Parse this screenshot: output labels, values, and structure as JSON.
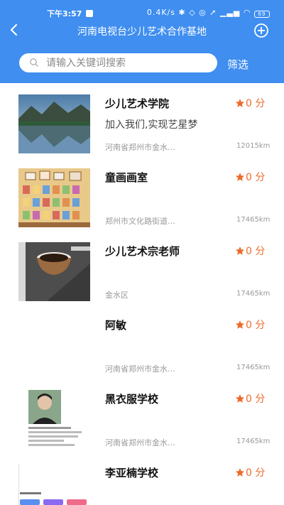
{
  "status_bar": {
    "time": "下午3:57",
    "speed": "0.4K/s",
    "icons": [
      "bluetooth-icon",
      "mute-icon",
      "alarm-icon",
      "location-icon",
      "signal-icon",
      "wifi-icon"
    ],
    "battery": "69"
  },
  "header": {
    "title": "河南电视台少儿艺术合作基地",
    "back_icon": "back-arrow-icon",
    "add_icon": "plus-circle-icon",
    "color": "#3f8ef0"
  },
  "search": {
    "placeholder": "请输入关键词搜索",
    "filter_label": "筛选"
  },
  "accent_color": "#ee6a2b",
  "items": [
    {
      "name": "少儿艺术学院",
      "rating": "0 分",
      "desc": "加入我们,实现艺星梦",
      "address": "河南省郑州市金水…",
      "distance": "12015km",
      "thumb": "lake-landscape"
    },
    {
      "name": "童画画室",
      "rating": "0 分",
      "desc": "",
      "address": "郑州市文化路街道…",
      "distance": "17465km",
      "thumb": "art-gallery"
    },
    {
      "name": "少儿艺术宗老师",
      "rating": "0 分",
      "desc": "",
      "address": "金水区",
      "distance": "17465km",
      "thumb": "tea-bowl"
    },
    {
      "name": "阿敏",
      "rating": "0 分",
      "desc": "",
      "address": "河南省郑州市金水…",
      "distance": "17465km",
      "thumb": "none"
    },
    {
      "name": "黑衣服学校",
      "rating": "0 分",
      "desc": "",
      "address": "河南省郑州市金水…",
      "distance": "17465km",
      "thumb": "profile-screenshot"
    },
    {
      "name": "李亚楠学校",
      "rating": "0 分",
      "desc": "",
      "address": "",
      "distance": "",
      "thumb": "data-screenshot"
    }
  ]
}
